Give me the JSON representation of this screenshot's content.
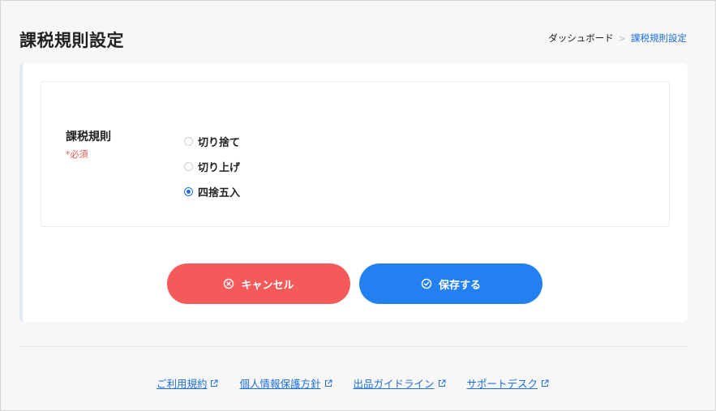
{
  "header": {
    "title": "課税規則設定",
    "breadcrumb": {
      "home": "ダッシュボード",
      "separator": ">",
      "current": "課税規則設定"
    }
  },
  "form": {
    "field_label": "課税規則",
    "required_label": "*必須",
    "options": [
      {
        "label": "切り捨て",
        "checked": false
      },
      {
        "label": "切り上げ",
        "checked": false
      },
      {
        "label": "四捨五入",
        "checked": true
      }
    ]
  },
  "actions": {
    "cancel_label": "キャンセル",
    "save_label": "保存する"
  },
  "footer": {
    "links": [
      {
        "label": "ご利用規約"
      },
      {
        "label": "個人情報保護方針"
      },
      {
        "label": "出品ガイドライン"
      },
      {
        "label": "サポートデスク"
      }
    ]
  },
  "colors": {
    "accent": "#1e6fd8",
    "cancel": "#f45a5a",
    "save": "#2280f0",
    "required": "#e05a4f"
  },
  "icons": {
    "cancel": "circle-x-icon",
    "save": "circle-check-icon",
    "external": "external-link-icon"
  }
}
